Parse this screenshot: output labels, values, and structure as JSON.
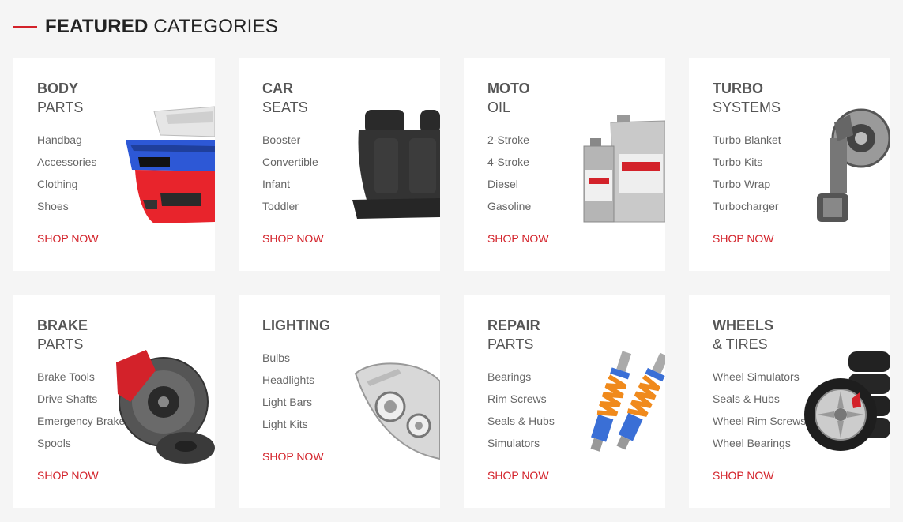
{
  "section": {
    "title_bold": "FEATURED",
    "title_light": "CATEGORIES",
    "accent": "#d3222a"
  },
  "categories": [
    {
      "line1": "BODY",
      "line2": "PARTS",
      "items": [
        "Handbag",
        "Accessories",
        "Clothing",
        "Shoes"
      ],
      "cta": "SHOP NOW",
      "image": "bumper"
    },
    {
      "line1": "CAR",
      "line2": "SEATS",
      "items": [
        "Booster",
        "Convertible",
        "Infant",
        "Toddler"
      ],
      "cta": "SHOP NOW",
      "image": "car-seat"
    },
    {
      "line1": "MOTO",
      "line2": "OIL",
      "items": [
        "2-Stroke",
        "4-Stroke",
        "Diesel",
        "Gasoline"
      ],
      "cta": "SHOP NOW",
      "image": "oil-bottles"
    },
    {
      "line1": "TURBO",
      "line2": "SYSTEMS",
      "items": [
        "Turbo Blanket",
        "Turbo Kits",
        "Turbo Wrap",
        "Turbocharger"
      ],
      "cta": "SHOP NOW",
      "image": "turbocharger"
    },
    {
      "line1": "BRAKE",
      "line2": "PARTS",
      "items": [
        "Brake Tools",
        "Drive Shafts",
        "Emergency Brake",
        "Spools"
      ],
      "cta": "SHOP NOW",
      "image": "brake-disc"
    },
    {
      "line1": "LIGHTING",
      "line2": "",
      "items": [
        "Bulbs",
        "Headlights",
        "Light Bars",
        "Light Kits"
      ],
      "cta": "SHOP NOW",
      "image": "headlight"
    },
    {
      "line1": "REPAIR",
      "line2": "PARTS",
      "items": [
        "Bearings",
        "Rim Screws",
        "Seals & Hubs",
        "Simulators"
      ],
      "cta": "SHOP NOW",
      "image": "shock-absorbers"
    },
    {
      "line1": "WHEELS",
      "line2": "& TIRES",
      "items": [
        "Wheel Simulators",
        "Seals & Hubs",
        "Wheel Rim Screws",
        "Wheel Bearings"
      ],
      "cta": "SHOP NOW",
      "image": "wheels-tires"
    }
  ]
}
